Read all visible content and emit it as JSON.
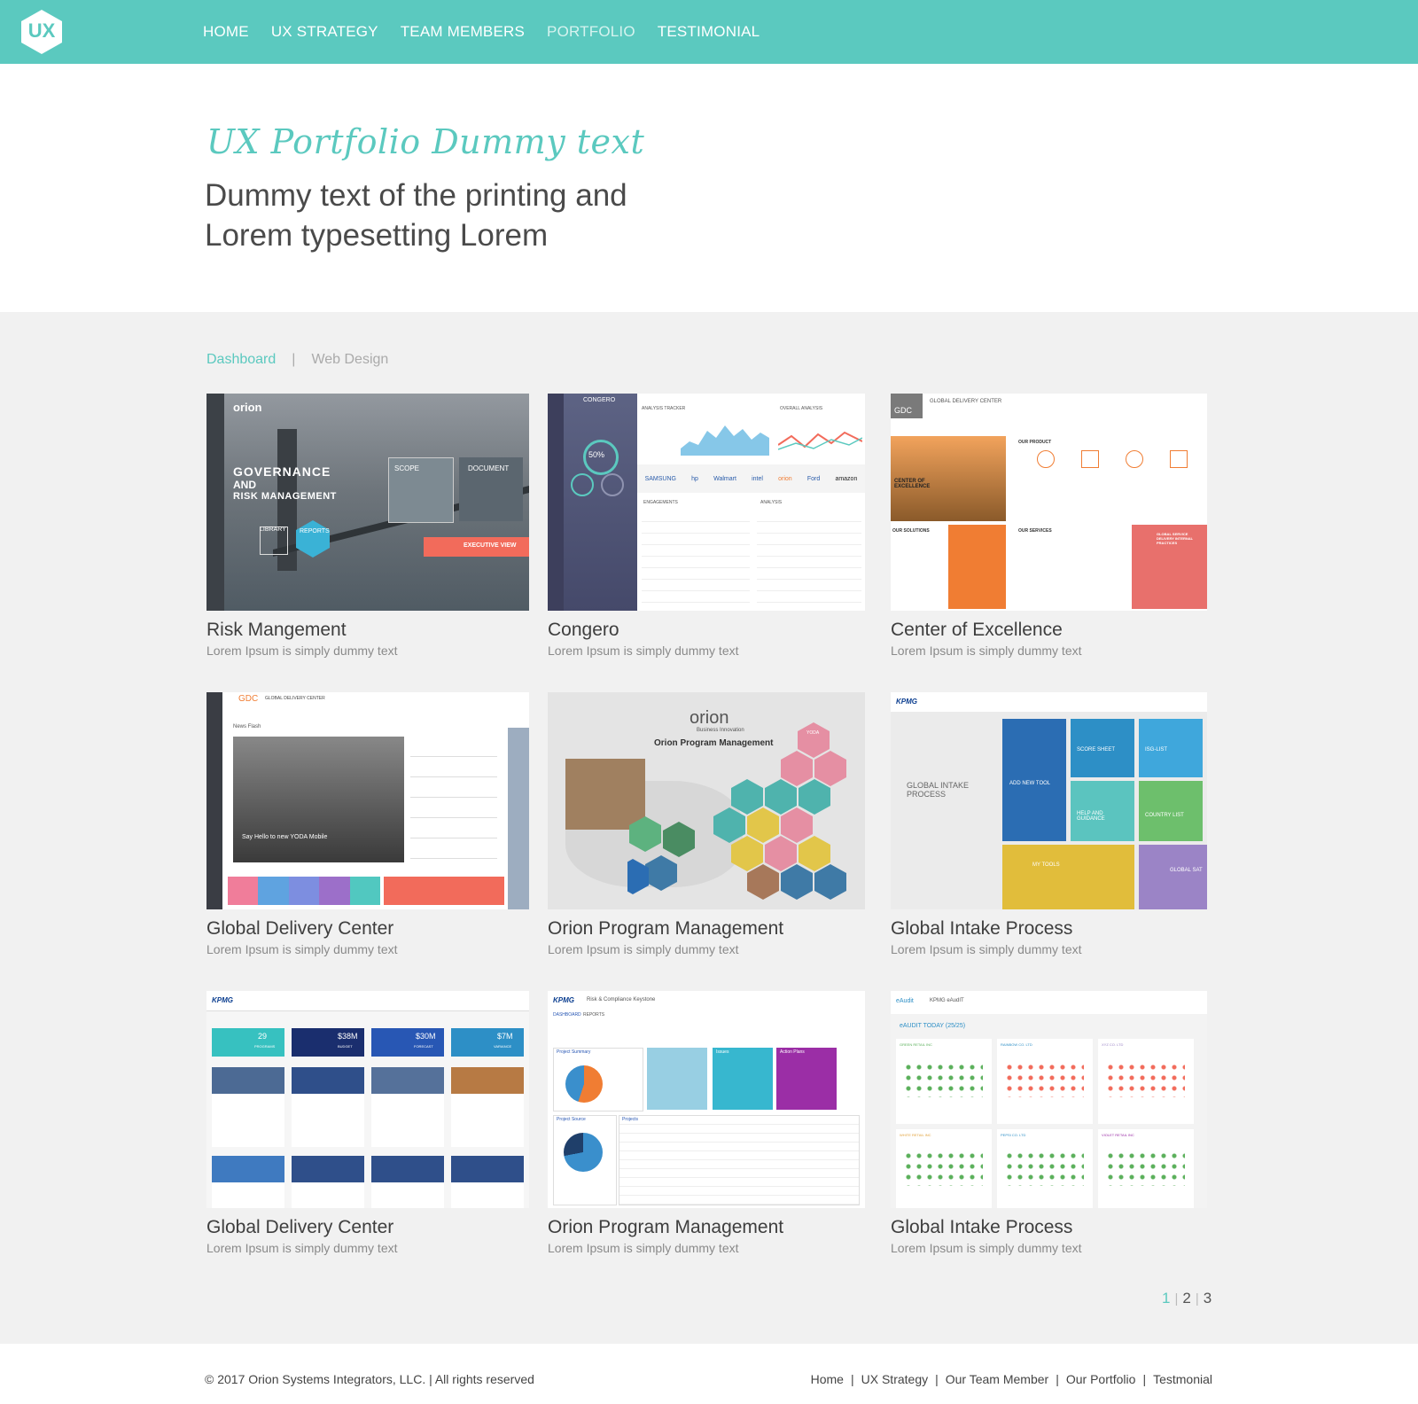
{
  "nav": {
    "logo_text": "UX",
    "links": [
      "HOME",
      "UX STRATEGY",
      "TEAM MEMBERS",
      "PORTFOLIO",
      "TESTIMONIAL"
    ],
    "active_index": 3
  },
  "hero": {
    "script_title": "UX Portfolio Dummy text",
    "title_line1": "Dummy text of the printing and",
    "title_line2": "Lorem typesetting Lorem"
  },
  "tabs": {
    "items": [
      "Dashboard",
      "Web Design"
    ],
    "separator": "|",
    "active_index": 0
  },
  "portfolio": [
    {
      "title": "Risk Mangement",
      "subtitle": "Lorem Ipsum is simply dummy text",
      "thumb_text": [
        "orion",
        "GOVERNANCE",
        "AND",
        "RISK MANAGEMENT",
        "SCOPE",
        "DOCUMENT",
        "LIBRARY",
        "REPORTS",
        "EXECUTIVE VIEW"
      ]
    },
    {
      "title": "Congero",
      "subtitle": "Lorem Ipsum is simply dummy text",
      "thumb_text": [
        "CONGERO",
        "ANALYSIS TRACKER",
        "OVERALL ANALYSIS",
        "50%",
        "SAMSUNG",
        "hp",
        "Walmart",
        "intel",
        "orion",
        "Ford",
        "amazon",
        "ENGAGEMENTS",
        "ANALYSIS"
      ]
    },
    {
      "title": "Center of Excellence",
      "subtitle": "Lorem Ipsum is simply dummy text",
      "thumb_text": [
        "GDC",
        "GLOBAL DELIVERY CENTER",
        "CENTER OF EXCELLENCE",
        "OUR PRODUCT",
        "OUR SOLUTIONS",
        "OUR SERVICES",
        "GLOBAL SERVICE DELIVERY INTERNAL PRACTICES"
      ]
    },
    {
      "title": "Global Delivery Center",
      "subtitle": "Lorem Ipsum is simply dummy text",
      "thumb_text": [
        "GDC",
        "GLOBAL DELIVERY CENTER",
        "News Flash",
        "Say Hello to new YODA Mobile"
      ]
    },
    {
      "title": "Orion Program Management",
      "subtitle": "Lorem Ipsum is simply dummy text",
      "thumb_text": [
        "orion",
        "Business Innovation",
        "Orion Program Management",
        "YODA"
      ]
    },
    {
      "title": "Global Intake Process",
      "subtitle": "Lorem Ipsum is simply dummy text",
      "thumb_text": [
        "KPMG",
        "GLOBAL INTAKE PROCESS",
        "ADD NEW TOOL",
        "SCORE SHEET",
        "ISG-LIST",
        "HELP AND GUIDANCE",
        "COUNTRY LIST",
        "MY TOOLS",
        "GLOBAL SAT"
      ]
    },
    {
      "title": "Global Delivery Center",
      "subtitle": "Lorem Ipsum is simply dummy text",
      "thumb_text": [
        "KPMG",
        "29",
        "PROGRAMS",
        "$38M",
        "BUDGET",
        "$30M",
        "FORECAST",
        "$7M",
        "VARIANCE"
      ]
    },
    {
      "title": "Orion Program Management",
      "subtitle": "Lorem Ipsum is simply dummy text",
      "thumb_text": [
        "KPMG",
        "Risk & Compliance Keystone",
        "DASHBOARD",
        "REPORTS",
        "Project Summary",
        "Issues",
        "Action Plans",
        "Project Source",
        "Projects"
      ]
    },
    {
      "title": "Global Intake Process",
      "subtitle": "Lorem Ipsum is simply dummy text",
      "thumb_text": [
        "eAudit",
        "KPMG eAudIT",
        "eAUDIT TODAY (25/25)",
        "GREEN RETAIL INC",
        "RAINBOW CO. LTD",
        "XYZ CO. LTD",
        "WHITE RETAIL INC",
        "PEPSI CO. LTD",
        "VIOLET RETAIL INC"
      ]
    }
  ],
  "pagination": {
    "pages": [
      "1",
      "2",
      "3"
    ],
    "active_index": 0,
    "separator": "|"
  },
  "footer": {
    "copyright": "© 2017 Orion Systems Integrators, LLC. | All rights reserved",
    "links": [
      "Home",
      "UX Strategy",
      "Our Team Member",
      "Our Portfolio",
      "Testmonial"
    ],
    "separator": "|"
  },
  "colors": {
    "brand_teal": "#5bc9bf",
    "orange": "#f07d33",
    "coral": "#f26b5b",
    "page_bg": "#f1f1f1"
  }
}
